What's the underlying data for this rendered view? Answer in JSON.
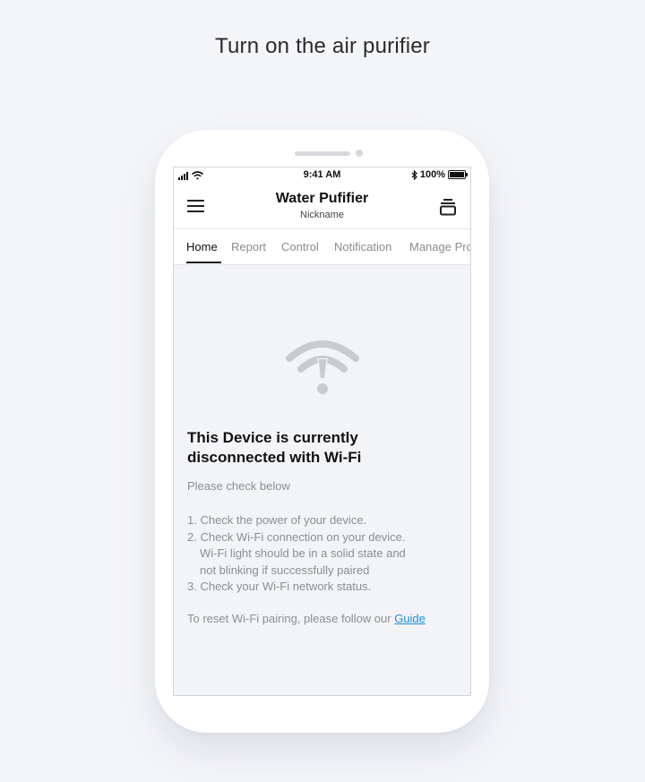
{
  "caption": "Turn on the air purifier",
  "status_bar": {
    "time": "9:41 AM",
    "battery": "100%"
  },
  "app_bar": {
    "title": "Water Pufifier",
    "subtitle": "Nickname"
  },
  "tabs": [
    {
      "label": "Home",
      "active": true
    },
    {
      "label": "Report"
    },
    {
      "label": "Control"
    },
    {
      "label": "Notification"
    },
    {
      "label": "Manage Pro"
    }
  ],
  "message": {
    "title": "This Device is currently disconnected with Wi-Fi",
    "check": "Please check below",
    "steps": [
      "1. Check the power of your device.",
      "2. Check Wi-Fi connection on your device.",
      "Wi-Fi light should be in a solid state and",
      "not blinking if successfully paired",
      "3. Check your Wi-Fi network status."
    ],
    "reset_text": "To reset Wi-Fi pairing, please follow our ",
    "guide_link": "Guide"
  },
  "icons": {
    "wifi_error": "wifi-off-icon",
    "menu": "hamburger-menu-icon",
    "device": "device-switch-icon"
  },
  "colors": {
    "link": "#1a8cd8",
    "icon_gray": "#c9cbd0",
    "background": "#f4f5f9"
  }
}
